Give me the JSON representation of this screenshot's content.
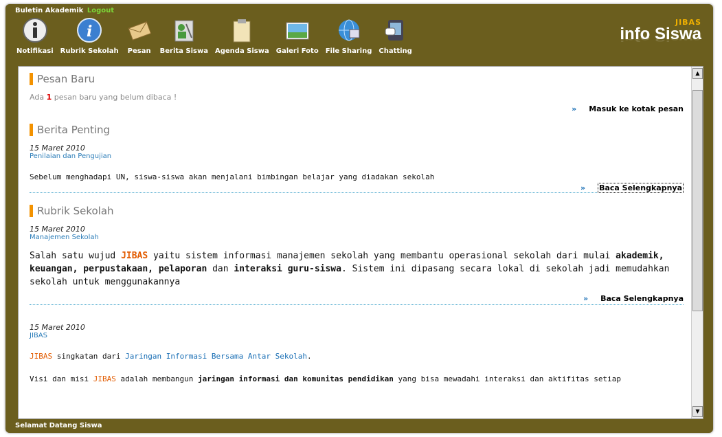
{
  "topbar": {
    "title": "Buletin Akademik",
    "logout": "Logout"
  },
  "nav": [
    {
      "label": "Notifikasi",
      "icon": "info-icon"
    },
    {
      "label": "Rubrik Sekolah",
      "icon": "info-circle-icon"
    },
    {
      "label": "Pesan",
      "icon": "envelope-icon"
    },
    {
      "label": "Berita Siswa",
      "icon": "news-icon"
    },
    {
      "label": "Agenda Siswa",
      "icon": "clipboard-icon"
    },
    {
      "label": "Galeri Foto",
      "icon": "photo-icon"
    },
    {
      "label": "File Sharing",
      "icon": "globe-icon"
    },
    {
      "label": "Chatting",
      "icon": "chat-icon"
    }
  ],
  "brand": {
    "jibas": "JIBAS",
    "title": "info Siswa"
  },
  "pesan": {
    "title": "Pesan Baru",
    "pre": "Ada ",
    "count": "1",
    "post": " pesan baru yang belum dibaca !",
    "link": "Masuk ke kotak pesan"
  },
  "berita": {
    "title": "Berita Penting",
    "date": "15 Maret 2010",
    "category": "Penilaian dan Pengujian",
    "text": "Sebelum menghadapi UN, siswa-siswa akan menjalani bimbingan belajar yang diadakan sekolah",
    "link": "Baca Selengkapnya"
  },
  "rubrik": {
    "title": "Rubrik Sekolah",
    "date": "15 Maret 2010",
    "category": "Manajemen Sekolah",
    "t1": "Salah satu wujud ",
    "jibas": "JIBAS",
    "t2": " yaitu sistem informasi manajemen sekolah yang membantu operasional sekolah dari mulai ",
    "b1": "akademik, keuangan, perpustakaan, pelaporan",
    "t3": " dan ",
    "b2": "interaksi guru-siswa",
    "t4": ". Sistem ini dipasang secara lokal di sekolah jadi memudahkan sekolah untuk menggunakannya",
    "link": "Baca Selengkapnya"
  },
  "item2": {
    "date": "15 Maret 2010",
    "category": "JIBAS",
    "jibas": "JIBAS",
    "t1": " singkatan dari ",
    "full": "Jaringan Informasi Bersama Antar Sekolah",
    "t2": ".",
    "v1": "Visi dan misi ",
    "vj": "JIBAS",
    "v2": " adalah membangun ",
    "vb": "jaringan informasi dan komunitas pendidikan",
    "v3": " yang bisa mewadahi interaksi dan aktifitas setiap"
  },
  "footer": "Selamat Datang Siswa"
}
